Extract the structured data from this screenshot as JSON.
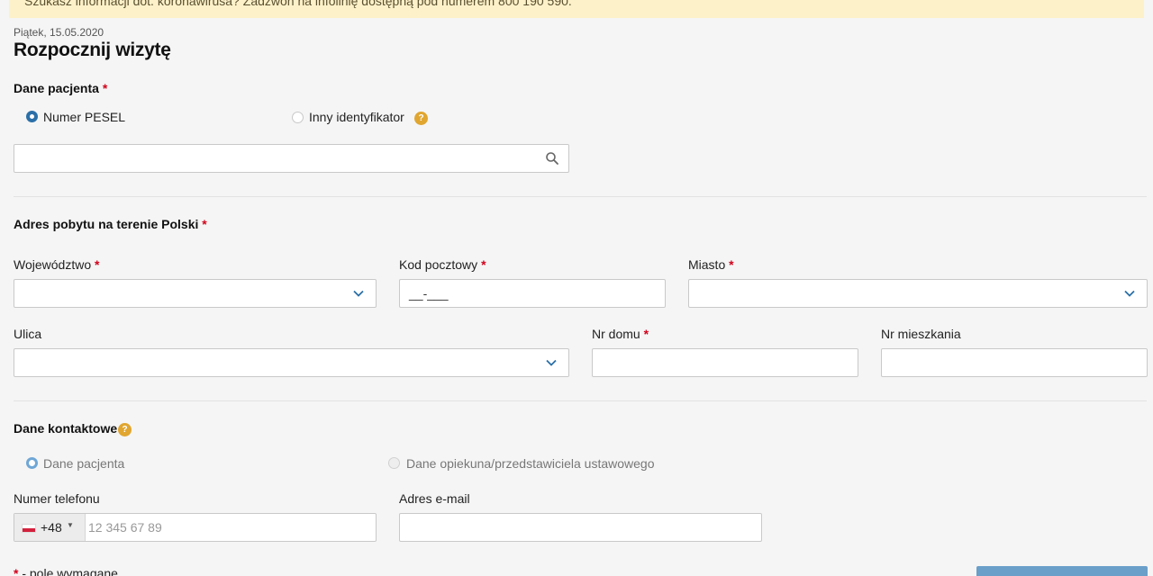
{
  "banner": {
    "text": "Szukasz informacji dot. koronawirusa? Zadzwoń na infolinię dostępną pod numerem 800 190 590."
  },
  "header": {
    "date": "Piątek, 15.05.2020",
    "title": "Rozpocznij wizytę"
  },
  "required_mark": "*",
  "help_glyph": "?",
  "patient": {
    "label": "Dane pacjenta",
    "radio_pesel": "Numer PESEL",
    "radio_other": "Inny identyfikator",
    "selected": "Numer PESEL",
    "search_value": ""
  },
  "address": {
    "label": "Adres pobytu na terenie Polski",
    "voivodeship_label": "Województwo",
    "postal_label": "Kod pocztowy",
    "postal_value": "__-___",
    "city_label": "Miasto",
    "street_label": "Ulica",
    "house_label": "Nr domu",
    "apartment_label": "Nr mieszkania"
  },
  "contact": {
    "label": "Dane kontaktowe",
    "radio_patient": "Dane pacjenta",
    "radio_guardian": "Dane opiekuna/przedstawiciela ustawowego",
    "selected": "Dane pacjenta",
    "phone_label": "Numer telefonu",
    "phone_prefix": "+48",
    "phone_placeholder": "12 345 67 89",
    "email_label": "Adres e-mail"
  },
  "footer": {
    "required_legend": "- pole wymagane"
  },
  "icons": [
    "search-icon",
    "chevron-down-icon",
    "help-icon",
    "poland-flag-icon",
    "caret-down-icon"
  ],
  "colors": {
    "accent": "#2b6fa8",
    "required": "#d0021b",
    "help": "#e0a630",
    "banner": "#fdf1c9"
  }
}
